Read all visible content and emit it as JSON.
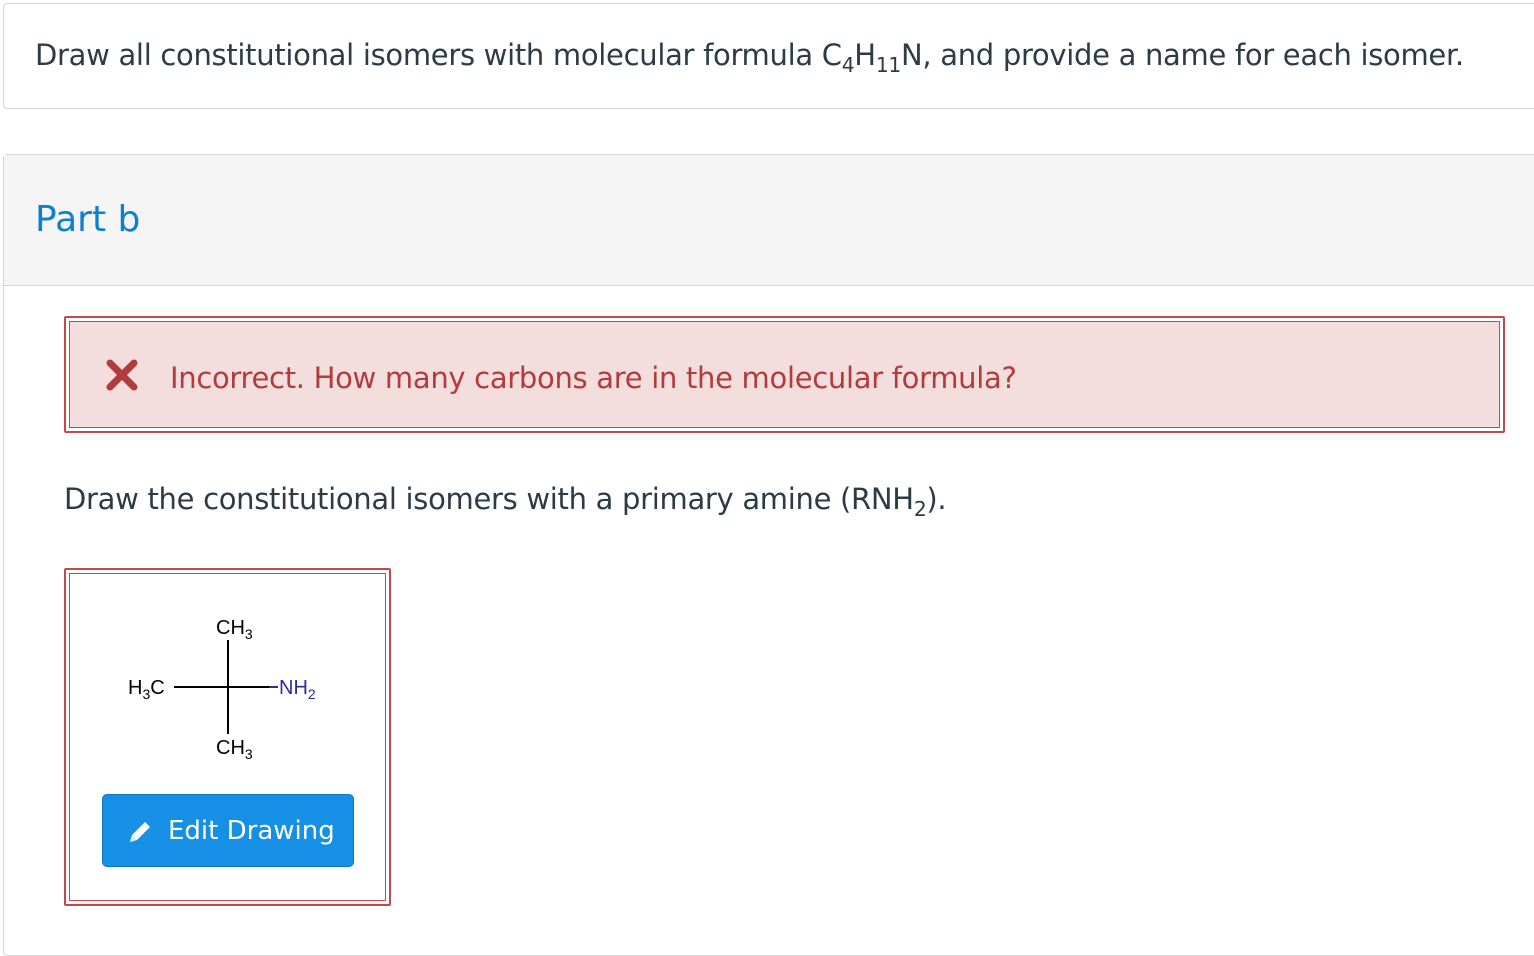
{
  "question": {
    "text_before": "Draw all constitutional isomers with molecular formula C",
    "c_sub": "4",
    "h": "H",
    "h_sub": "11",
    "text_after": "N, and provide a name for each isomer."
  },
  "part": {
    "title": "Part b"
  },
  "feedback": {
    "icon": "x-icon",
    "status_color": "#b23b3b",
    "text": "Incorrect. How many carbons are in the molecular formula?"
  },
  "prompt": {
    "text_before": "Draw the constitutional isomers with a primary amine (RNH",
    "sub": "2",
    "text_after": ")."
  },
  "drawing": {
    "top_group": "CH",
    "top_sub": "3",
    "left_group": "H",
    "left_sub": "3",
    "left_tail": "C",
    "right_group": "NH",
    "right_sub": "2",
    "bottom_group": "CH",
    "bottom_sub": "3",
    "amine_color": "#2c2c9a"
  },
  "edit_button": {
    "icon": "pencil-icon",
    "label": "Edit Drawing",
    "color": "#1590e4"
  }
}
